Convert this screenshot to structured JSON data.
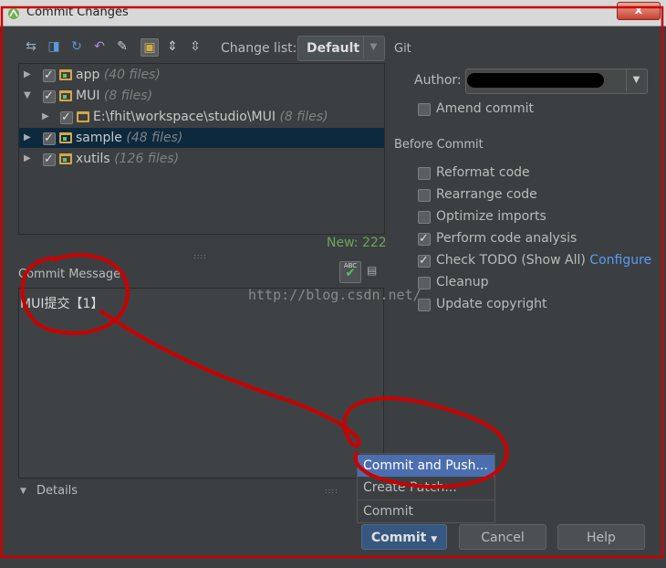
{
  "window": {
    "title": "Commit Changes",
    "close_glyph": "x"
  },
  "toolbar": {
    "icons": [
      "diff-icon",
      "move-icon",
      "refresh-icon",
      "rollback-icon",
      "edit-icon",
      "group-icon",
      "expand-all-icon",
      "collapse-all-icon"
    ],
    "changelist_label": "Change list:",
    "changelist_value": "Default"
  },
  "tree": {
    "items": [
      {
        "name": "app",
        "count": "(40 files)"
      },
      {
        "name": "MUI",
        "count": "(8 files)"
      },
      {
        "name": "E:\\fhit\\workspace\\studio\\MUI",
        "count": "(8 files)"
      },
      {
        "name": "sample",
        "count": "(48 files)"
      },
      {
        "name": "xutils",
        "count": "(126 files)"
      }
    ],
    "new_count": "New: 222"
  },
  "commit_message": {
    "label": "Commit Message",
    "text": "MUI提交【1】",
    "watermark": "http://blog.csdn.net/"
  },
  "details_label": "Details",
  "git": {
    "section_label": "Git",
    "author_label": "Author:",
    "amend_label": "Amend commit"
  },
  "before_commit": {
    "section_label": "Before Commit",
    "options": [
      {
        "label": "Reformat code",
        "checked": false
      },
      {
        "label": "Rearrange code",
        "checked": false
      },
      {
        "label": "Optimize imports",
        "checked": false
      },
      {
        "label": "Perform code analysis",
        "checked": true
      },
      {
        "label": "Check TODO (Show All)",
        "checked": true,
        "link": "Configure"
      },
      {
        "label": "Cleanup",
        "checked": false
      },
      {
        "label": "Update copyright",
        "checked": false
      }
    ]
  },
  "popup": {
    "items": [
      "Commit and Push...",
      "Create Patch...",
      "Commit"
    ]
  },
  "buttons": {
    "commit": "Commit",
    "cancel": "Cancel",
    "help": "Help"
  },
  "colors": {
    "background": "#3c3f41",
    "selection": "#0d293e",
    "accent": "#4b6eaf",
    "link": "#589df6",
    "annotation": "#cc0000"
  }
}
